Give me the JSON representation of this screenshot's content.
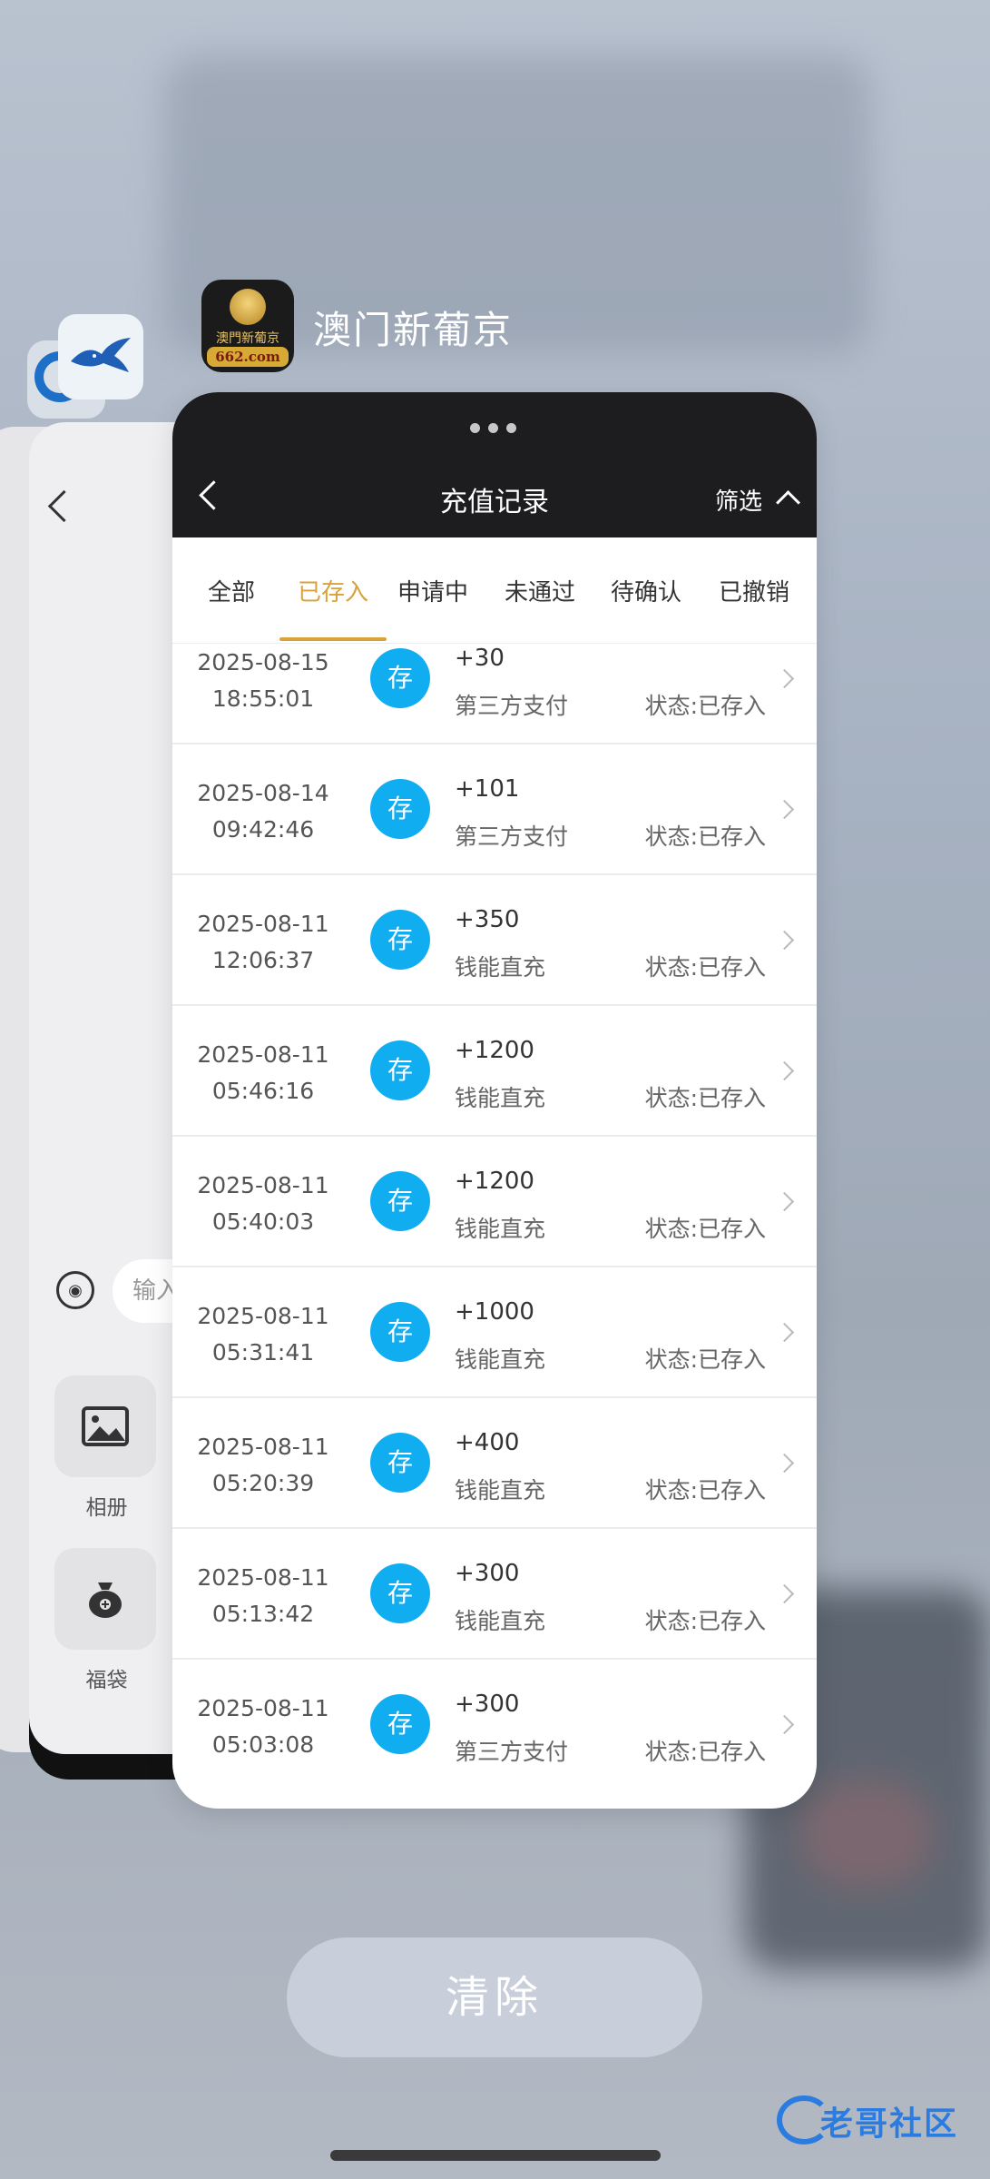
{
  "app": {
    "name": "澳门新葡京",
    "icon_cn": "澳門新葡京",
    "icon_domain": "662.com"
  },
  "back_cards": {
    "input_placeholder": "输入",
    "tools": [
      "相册",
      "福袋"
    ]
  },
  "nav": {
    "title": "充值记录",
    "filter_label": "筛选"
  },
  "tabs": [
    "全部",
    "已存入",
    "申请中",
    "未通过",
    "待确认",
    "已撤销"
  ],
  "active_tab_index": 1,
  "records": [
    {
      "date": "2025-08-15",
      "time": "18:55:01",
      "badge": "存",
      "amount": "+30",
      "method": "第三方支付",
      "status": "状态:已存入"
    },
    {
      "date": "2025-08-14",
      "time": "09:42:46",
      "badge": "存",
      "amount": "+101",
      "method": "第三方支付",
      "status": "状态:已存入"
    },
    {
      "date": "2025-08-11",
      "time": "12:06:37",
      "badge": "存",
      "amount": "+350",
      "method": "钱能直充",
      "status": "状态:已存入"
    },
    {
      "date": "2025-08-11",
      "time": "05:46:16",
      "badge": "存",
      "amount": "+1200",
      "method": "钱能直充",
      "status": "状态:已存入"
    },
    {
      "date": "2025-08-11",
      "time": "05:40:03",
      "badge": "存",
      "amount": "+1200",
      "method": "钱能直充",
      "status": "状态:已存入"
    },
    {
      "date": "2025-08-11",
      "time": "05:31:41",
      "badge": "存",
      "amount": "+1000",
      "method": "钱能直充",
      "status": "状态:已存入"
    },
    {
      "date": "2025-08-11",
      "time": "05:20:39",
      "badge": "存",
      "amount": "+400",
      "method": "钱能直充",
      "status": "状态:已存入"
    },
    {
      "date": "2025-08-11",
      "time": "05:13:42",
      "badge": "存",
      "amount": "+300",
      "method": "钱能直充",
      "status": "状态:已存入"
    },
    {
      "date": "2025-08-11",
      "time": "05:03:08",
      "badge": "存",
      "amount": "+300",
      "method": "第三方支付",
      "status": "状态:已存入"
    }
  ],
  "clear_button": "清除",
  "watermark": "老哥社区",
  "colors": {
    "accent_gold": "#d9a23a",
    "badge_blue": "#10aef0",
    "header_dark": "#1d1d1f"
  }
}
